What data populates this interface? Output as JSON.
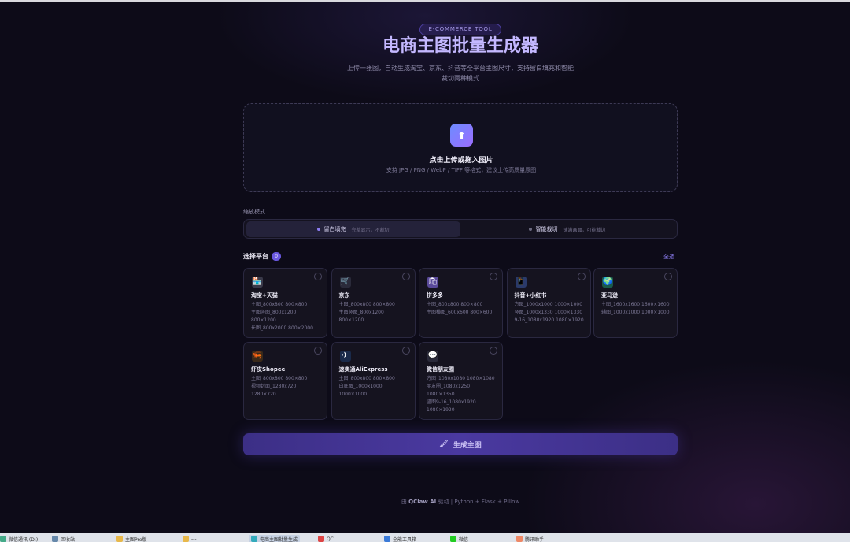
{
  "header": {
    "badge": "E-COMMERCE TOOL",
    "title": "电商主图批量生成器",
    "subtitle": "上传一张图，自动生成淘宝、京东、抖音等全平台主图尺寸，支持留白填充和智能裁切两种模式"
  },
  "upload": {
    "icon": "upload-icon",
    "title": "点击上传或拖入图片",
    "hint": "支持 JPG / PNG / WebP / TIFF 等格式，建议上传高质量原图"
  },
  "mode": {
    "label": "缩放模式",
    "options": [
      {
        "name": "留白填充",
        "desc": "完整显示，不裁切",
        "active": true
      },
      {
        "name": "智能裁切",
        "desc": "铺满画面，可能裁边",
        "active": false
      }
    ]
  },
  "platforms": {
    "title": "选择平台",
    "count": "0",
    "select_all": "全选",
    "items": [
      {
        "icon": "🏪",
        "name": "淘宝+天猫",
        "specs": [
          "主图_800x800 800×800",
          "主图竖图_800x1200",
          "800×1200",
          "长图_800x2000 800×2000"
        ]
      },
      {
        "icon": "🛒",
        "name": "京东",
        "specs": [
          "主图_800x800 800×800",
          "主图竖图_800x1200",
          "800×1200"
        ]
      },
      {
        "icon": "🛍",
        "name": "拼多多",
        "specs": [
          "主图_800x800 800×800",
          "主图横图_600x600 800×600"
        ]
      },
      {
        "icon": "📱",
        "name": "抖音+小红书",
        "specs": [
          "方图_1000x1000 1000×1000",
          "竖图_1000x1330 1000×1330",
          "9-16_1080x1920 1080×1920"
        ]
      },
      {
        "icon": "🌍",
        "name": "亚马逊",
        "specs": [
          "主图_1600x1600 1600×1600",
          "辅图_1000x1000 1000×1000"
        ]
      },
      {
        "icon": "🦐",
        "name": "虾皮Shopee",
        "specs": [
          "主图_800x800 800×800",
          "视频封面_1280x720",
          "1280×720"
        ]
      },
      {
        "icon": "✈",
        "name": "速卖通AliExpress",
        "specs": [
          "主图_800x800 800×800",
          "白底图_1000x1000",
          "1000×1000"
        ]
      },
      {
        "icon": "💬",
        "name": "微信朋友圈",
        "specs": [
          "方图_1080x1080 1080×1080",
          "朋友圈_1080x1250",
          "1080×1350",
          "竖图9-16_1080x1920",
          "1080×1920"
        ]
      }
    ]
  },
  "generate": {
    "icon": "🖌",
    "label": "生成主图"
  },
  "footer": {
    "prefix": "由 ",
    "brand": "QClaw AI",
    "suffix": " 驱动 | Python + Flask + Pillow"
  },
  "taskbar": [
    {
      "label": "微信通讯 (D:)",
      "color": "#4a8"
    },
    {
      "label": "回收站",
      "color": "#68a"
    },
    {
      "label": "主图Pro版",
      "color": "#e8b84a"
    },
    {
      "label": "---",
      "color": "#e8b84a"
    },
    {
      "label": "电商主图批量生成",
      "color": "#3ab",
      "active": true
    },
    {
      "label": "QCl...",
      "color": "#d44"
    },
    {
      "label": "全能工具箱",
      "color": "#3a7ad8"
    },
    {
      "label": "微信",
      "color": "#2c2"
    },
    {
      "label": "腾讯助手",
      "color": "#e86"
    }
  ]
}
